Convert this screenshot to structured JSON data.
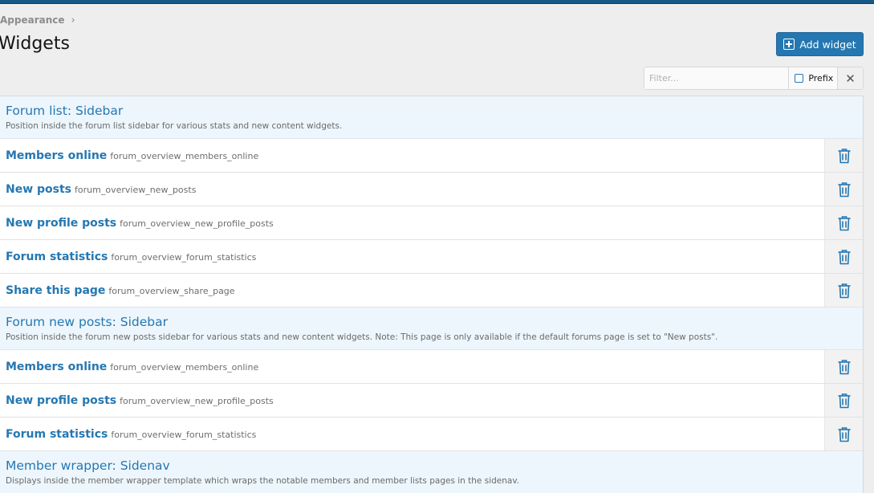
{
  "breadcrumb": {
    "label": "Appearance",
    "separator": "›"
  },
  "page": {
    "title": "Widgets"
  },
  "toolbar": {
    "add_label": "Add widget"
  },
  "filter": {
    "placeholder": "Filter...",
    "value": "",
    "prefix_label": "Prefix",
    "clear_glyph": "✕"
  },
  "colors": {
    "accent": "#2577b1",
    "header_bg": "#edf6fd",
    "topbar": "#185886"
  },
  "groups": [
    {
      "title": "Forum list: Sidebar",
      "description": "Position inside the forum list sidebar for various stats and new content widgets.",
      "widgets": [
        {
          "title": "Members online",
          "key": "forum_overview_members_online"
        },
        {
          "title": "New posts",
          "key": "forum_overview_new_posts"
        },
        {
          "title": "New profile posts",
          "key": "forum_overview_new_profile_posts"
        },
        {
          "title": "Forum statistics",
          "key": "forum_overview_forum_statistics"
        },
        {
          "title": "Share this page",
          "key": "forum_overview_share_page"
        }
      ]
    },
    {
      "title": "Forum new posts: Sidebar",
      "description": "Position inside the forum new posts sidebar for various stats and new content widgets. Note: This page is only available if the default forums page is set to \"New posts\".",
      "widgets": [
        {
          "title": "Members online",
          "key": "forum_overview_members_online"
        },
        {
          "title": "New profile posts",
          "key": "forum_overview_new_profile_posts"
        },
        {
          "title": "Forum statistics",
          "key": "forum_overview_forum_statistics"
        }
      ]
    },
    {
      "title": "Member wrapper: Sidenav",
      "description": "Displays inside the member wrapper template which wraps the notable members and member lists pages in the sidenav.",
      "widgets": []
    }
  ]
}
